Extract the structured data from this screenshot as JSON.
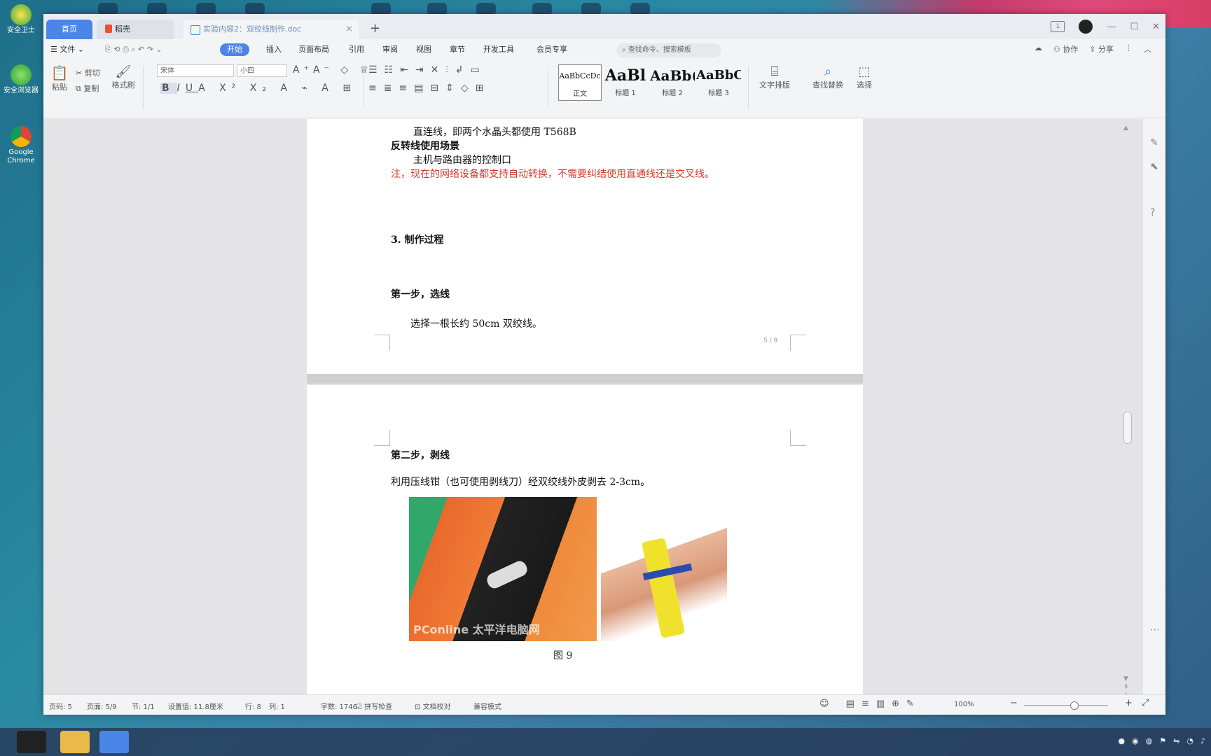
{
  "desktop": {
    "icons": [
      {
        "label": "安全卫士"
      },
      {
        "label": "安全浏览器"
      },
      {
        "label": "Google Chrome"
      }
    ]
  },
  "window": {
    "tabs": [
      {
        "label": "首页"
      },
      {
        "label": "稻壳"
      },
      {
        "label": "实验内容2：双绞线制作.doc"
      }
    ],
    "new_tab": "+"
  },
  "menu": {
    "file": "文件",
    "items": [
      "开始",
      "插入",
      "页面布局",
      "引用",
      "审阅",
      "视图",
      "章节",
      "开发工具",
      "会员专享"
    ],
    "search_placeholder": "查找命令、搜索模板",
    "right": [
      "协作",
      "分享"
    ]
  },
  "ribbon": {
    "paste": "粘贴",
    "cut": "剪切",
    "copy": "复制",
    "format_painter": "格式刷",
    "font_name": "宋体",
    "font_size": "小四",
    "styles": [
      {
        "preview": "AaBbCcDc",
        "label": "正文"
      },
      {
        "preview": "AaBl",
        "label": "标题 1"
      },
      {
        "preview": "AaBb(",
        "label": "标题 2"
      },
      {
        "preview": "AaBbC",
        "label": "标题 3"
      }
    ],
    "text_layout": "文字排版",
    "find_replace": "查找替换",
    "select": "选择"
  },
  "document": {
    "page1": {
      "line1": "直连线，即两个水晶头都使用 T568B",
      "line2": "反转线使用场景",
      "line3": "主机与路由器的控制口",
      "note": "注，现在的网络设备都支持自动转换，不需要纠结使用直通线还是交叉线。",
      "section": "3. 制作过程",
      "step1": "第一步，选线",
      "step1_desc": "选择一根长约 50cm 双绞线。",
      "page_no": "5 / 9"
    },
    "page2": {
      "step2": "第二步，剥线",
      "step2_desc": "利用压线钳（也可使用剥线刀）经双绞线外皮剥去 2-3cm。",
      "watermark": "PConline 太平洋电脑网",
      "caption": "图 9"
    }
  },
  "status": {
    "page": "页码: 5",
    "pages": "页面: 5/9",
    "section": "节: 1/1",
    "position": "设置值: 11.8厘米",
    "row": "行: 8",
    "col": "列: 1",
    "words": "字数: 1746",
    "spell": "拼写检查",
    "proof": "文档校对",
    "compat": "兼容模式",
    "zoom": "100%"
  }
}
